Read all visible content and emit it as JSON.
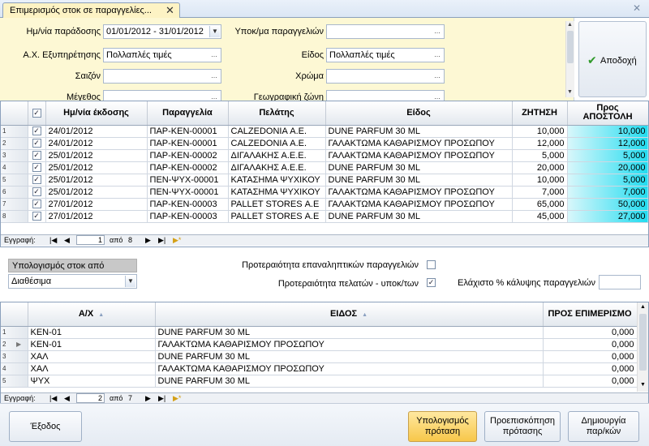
{
  "tab": {
    "title": "Επιμερισμός στοκ σε παραγγελίες...",
    "close": "✕"
  },
  "window": {
    "close": "✕"
  },
  "filters": {
    "delivery_date": {
      "label": "Ημ/νία παράδοσης",
      "value": "01/01/2012 - 31/01/2012"
    },
    "service_store": {
      "label": "Α.Χ. Εξυπηρέτησης",
      "value": "Πολλαπλές τιμές"
    },
    "season": {
      "label": "Σαιζόν",
      "value": ""
    },
    "size": {
      "label": "Μέγεθος",
      "value": ""
    },
    "order_type": {
      "label": "Υποκ/μα παραγγελιών",
      "value": ""
    },
    "item": {
      "label": "Είδος",
      "value": "Πολλαπλές τιμές"
    },
    "color": {
      "label": "Χρώμα",
      "value": ""
    },
    "geo_zone": {
      "label": "Γεωγραφική ζώνη",
      "value": ""
    },
    "ellipsis": "..."
  },
  "accept_button": {
    "label": "Αποδοχή"
  },
  "orders_grid": {
    "columns": {
      "issue_date": "Ημ/νία έκδοσης",
      "order": "Παραγγελία",
      "customer": "Πελάτης",
      "item": "Είδος",
      "demand": "ΖΗΤΗΣΗ",
      "to_send_1": "Προς",
      "to_send_2": "ΑΠΟΣΤΟΛΗ"
    },
    "rows": [
      {
        "n": "1",
        "date": "24/01/2012",
        "order": "ΠΑΡ-ΚΕΝ-00001",
        "customer": "CALZEDONIA Α.Ε.",
        "item": "DUNE PARFUM 30 ML",
        "demand": "10,000",
        "send": "10,000"
      },
      {
        "n": "2",
        "date": "24/01/2012",
        "order": "ΠΑΡ-ΚΕΝ-00001",
        "customer": "CALZEDONIA Α.Ε.",
        "item": "ΓΑΛΑΚΤΩΜΑ ΚΑΘΑΡΙΣΜΟΥ ΠΡΟΣΩΠΟΥ",
        "demand": "12,000",
        "send": "12,000"
      },
      {
        "n": "3",
        "date": "25/01/2012",
        "order": "ΠΑΡ-ΚΕΝ-00002",
        "customer": "ΔΙΓΑΛΑΚΗΣ Α.Ε.Ε.",
        "item": "ΓΑΛΑΚΤΩΜΑ ΚΑΘΑΡΙΣΜΟΥ ΠΡΟΣΩΠΟΥ",
        "demand": "5,000",
        "send": "5,000"
      },
      {
        "n": "4",
        "date": "25/01/2012",
        "order": "ΠΑΡ-ΚΕΝ-00002",
        "customer": "ΔΙΓΑΛΑΚΗΣ Α.Ε.Ε.",
        "item": "DUNE PARFUM 30 ML",
        "demand": "20,000",
        "send": "20,000"
      },
      {
        "n": "5",
        "date": "25/01/2012",
        "order": "ΠΕΝ-ΨΥΧ-00001",
        "customer": "ΚΑΤΑΣΗΜΑ ΨΥΧΙΚΟΥ",
        "item": "DUNE PARFUM 30 ML",
        "demand": "10,000",
        "send": "5,000"
      },
      {
        "n": "6",
        "date": "25/01/2012",
        "order": "ΠΕΝ-ΨΥΧ-00001",
        "customer": "ΚΑΤΑΣΗΜΑ ΨΥΧΙΚΟΥ",
        "item": "ΓΑΛΑΚΤΩΜΑ ΚΑΘΑΡΙΣΜΟΥ ΠΡΟΣΩΠΟΥ",
        "demand": "7,000",
        "send": "7,000"
      },
      {
        "n": "7",
        "date": "27/01/2012",
        "order": "ΠΑΡ-ΚΕΝ-00003",
        "customer": "PALLET STORES Α.Ε",
        "item": "ΓΑΛΑΚΤΩΜΑ ΚΑΘΑΡΙΣΜΟΥ ΠΡΟΣΩΠΟΥ",
        "demand": "65,000",
        "send": "50,000"
      },
      {
        "n": "8",
        "date": "27/01/2012",
        "order": "ΠΑΡ-ΚΕΝ-00003",
        "customer": "PALLET STORES Α.Ε",
        "item": "DUNE PARFUM 30 ML",
        "demand": "45,000",
        "send": "27,000"
      }
    ],
    "nav": {
      "label": "Εγγραφή:",
      "current": "1",
      "of": "από",
      "total": "8"
    }
  },
  "calc_stock": {
    "label": "Υπολογισμός στοκ από",
    "value": "Διαθέσιμα"
  },
  "options": {
    "repeat_priority": {
      "label": "Προτεραιότητα επαναληπτικών παραγγελιών",
      "checked": false
    },
    "customer_priority": {
      "label": "Προτεραιότητα πελατών - υποκ/των",
      "checked": true
    },
    "min_coverage": {
      "label": "Ελάχιστο % κάλυψης παραγγελιών",
      "value": ""
    }
  },
  "allocation_grid": {
    "columns": {
      "ax": "Α/Χ",
      "item": "ΕΙΔΟΣ",
      "to_allocate": "ΠΡΟΣ ΕΠΙΜΕΡΙΣΜΟ"
    },
    "rows": [
      {
        "n": "1",
        "ax": "ΚΕΝ-01",
        "item": "DUNE PARFUM 30 ML",
        "qty": "0,000"
      },
      {
        "n": "2",
        "ax": "ΚΕΝ-01",
        "item": "ΓΑΛΑΚΤΩΜΑ ΚΑΘΑΡΙΣΜΟΥ ΠΡΟΣΩΠΟΥ",
        "qty": "0,000"
      },
      {
        "n": "3",
        "ax": "ΧΑΛ",
        "item": "DUNE PARFUM 30 ML",
        "qty": "0,000"
      },
      {
        "n": "4",
        "ax": "ΧΑΛ",
        "item": "ΓΑΛΑΚΤΩΜΑ ΚΑΘΑΡΙΣΜΟΥ ΠΡΟΣΩΠΟΥ",
        "qty": "0,000"
      },
      {
        "n": "5",
        "ax": "ΨΥΧ",
        "item": "DUNE PARFUM 30 ML",
        "qty": "0,000"
      }
    ],
    "nav": {
      "label": "Εγγραφή:",
      "current": "2",
      "of": "από",
      "total": "7"
    }
  },
  "buttons": {
    "exit": "Έξοδος",
    "calc_1": "Υπολογισμός",
    "calc_2": "πρόταση",
    "preview_1": "Προεπισκόπηση",
    "preview_2": "πρότασης",
    "create_1": "Δημιουργία",
    "create_2": "παρ/κών"
  },
  "colors": {
    "accent_cyan": "#22dcf0",
    "filter_bg": "#fdf8d4",
    "primary_button": "#f7c74a"
  }
}
